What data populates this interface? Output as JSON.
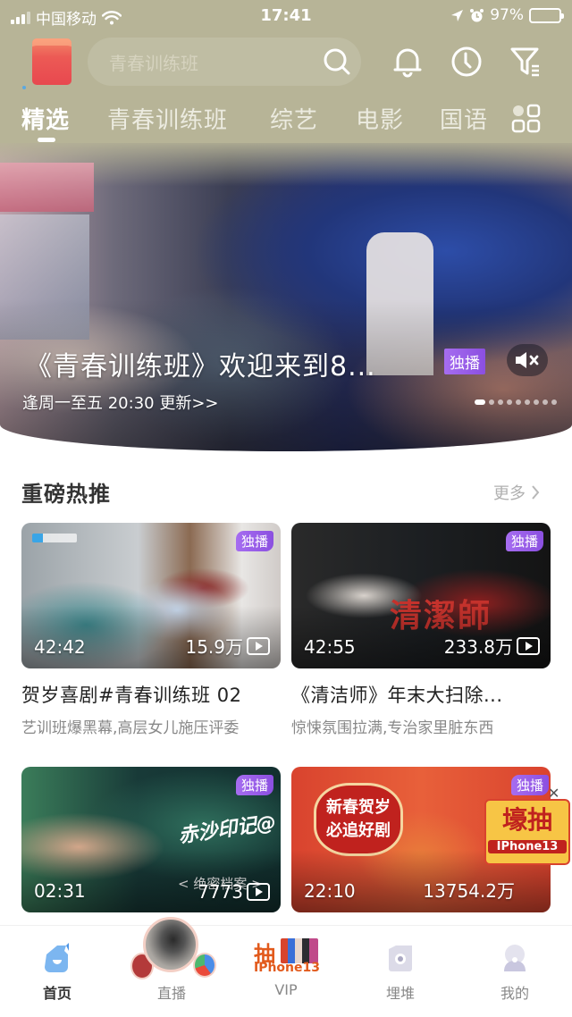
{
  "status_bar": {
    "carrier": "中国移动",
    "time": "17:41",
    "battery_percent": "97%",
    "battery_level": 0.97
  },
  "header": {
    "search_placeholder": "青春训练班",
    "icons": [
      "red-packet-icon",
      "search-icon",
      "bell-icon",
      "clock-icon",
      "filter-icon"
    ]
  },
  "tabs": [
    {
      "label": "精选",
      "active": true
    },
    {
      "label": "青春训练班",
      "active": false
    },
    {
      "label": "综艺",
      "active": false
    },
    {
      "label": "电影",
      "active": false
    },
    {
      "label": "国语",
      "active": false
    }
  ],
  "hero": {
    "title": "《青春训练班》欢迎来到8...",
    "subtitle": "逢周一至五 20:30 更新>>",
    "badge": "独播",
    "carousel_count": 9,
    "carousel_active": 0
  },
  "section": {
    "title": "重磅热推",
    "more_label": "更多"
  },
  "cards": [
    {
      "badge": "独播",
      "duration": "42:42",
      "views": "15.9万",
      "title": "贺岁喜剧#青春训练班 02",
      "desc": "艺训班爆黑幕,高层女儿施压评委"
    },
    {
      "badge": "独播",
      "duration": "42:55",
      "views": "233.8万",
      "title": "《清洁师》年末大扫除...",
      "desc": "惊悚氛围拉满,专治家里脏东西",
      "poster_text": "清潔師"
    },
    {
      "badge": "独播",
      "duration": "02:31",
      "views": "7773",
      "poster_text": "赤沙印记@",
      "poster_sub": "< 绝密档案 >"
    },
    {
      "badge": "独播",
      "duration": "22:10",
      "views": "13754.2万",
      "poster_text": "新春贺岁 必追好剧",
      "ad_big": "壕抽",
      "ad_small": "IPhone13"
    }
  ],
  "bottom_nav": [
    {
      "label": "首页",
      "icon": "home-icon",
      "active": true
    },
    {
      "label": "直播",
      "icon": "live-avatar-icon",
      "active": false
    },
    {
      "label": "VIP",
      "icon": "vip-promo-icon",
      "active": false,
      "promo_big": "抽",
      "promo_brand": "IPhone13"
    },
    {
      "label": "埋堆",
      "icon": "community-icon",
      "active": false
    },
    {
      "label": "我的",
      "icon": "profile-icon",
      "active": false
    }
  ]
}
